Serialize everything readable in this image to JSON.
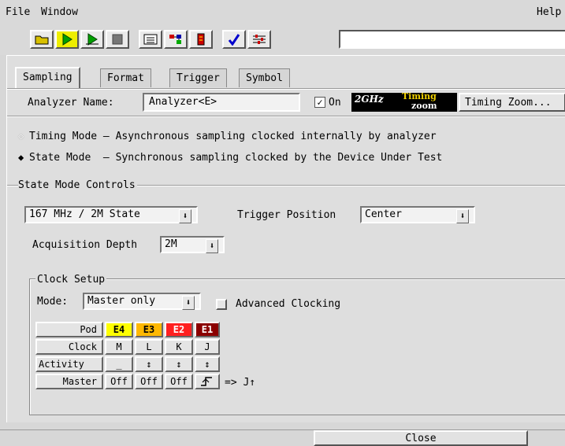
{
  "menubar": {
    "file": "File",
    "window": "Window",
    "help": "Help"
  },
  "toolbar": {
    "icons": [
      "open-file-icon",
      "run-single-icon",
      "run-repetitive-icon",
      "stop-icon",
      "listing-icon",
      "overview-icon",
      "config-icon",
      "check-icon",
      "setup-icon"
    ]
  },
  "tabs": [
    {
      "label": "Sampling",
      "active": true
    },
    {
      "label": "Format",
      "active": false
    },
    {
      "label": "Trigger",
      "active": false
    },
    {
      "label": "Symbol",
      "active": false
    }
  ],
  "analyzer": {
    "name_label": "Analyzer Name:",
    "name_value": "Analyzer<E>",
    "on_label": "On",
    "on_checked": true,
    "badge_2ghz": "2GHz",
    "badge_timing": "Timing",
    "badge_zoom": "zoom",
    "timing_zoom_button": "Timing Zoom..."
  },
  "modes": {
    "timing": "Timing Mode – Asynchronous sampling clocked internally by analyzer",
    "state": "State Mode  – Synchronous sampling clocked by the Device Under Test",
    "selected": "state"
  },
  "state_controls": {
    "title": "State Mode Controls",
    "rate_value": "167 MHz / 2M State",
    "trigger_position_label": "Trigger Position",
    "trigger_position_value": "Center",
    "acq_depth_label": "Acquisition Depth",
    "acq_depth_value": "2M"
  },
  "clock_setup": {
    "title": "Clock Setup",
    "mode_label": "Mode:",
    "mode_value": "Master only",
    "advanced_label": "Advanced Clocking",
    "advanced_checked": false
  },
  "pod_table": {
    "row_headers": [
      "Pod",
      "Clock",
      "Activity",
      "Master"
    ],
    "pods": [
      "E4",
      "E3",
      "E2",
      "E1"
    ],
    "pod_colors": [
      "#ffff00",
      "#ffb800",
      "#ff2020",
      "#8b0000"
    ],
    "pod_text_colors": [
      "#000000",
      "#000000",
      "#ffffff",
      "#ffffff"
    ],
    "clocks": [
      "M",
      "L",
      "K",
      "J"
    ],
    "activity": [
      "_",
      "↕",
      "↕",
      "↕"
    ],
    "master": [
      "Off",
      "Off",
      "Off",
      ""
    ],
    "result": "=> J↑"
  },
  "footer": {
    "close": "Close"
  }
}
